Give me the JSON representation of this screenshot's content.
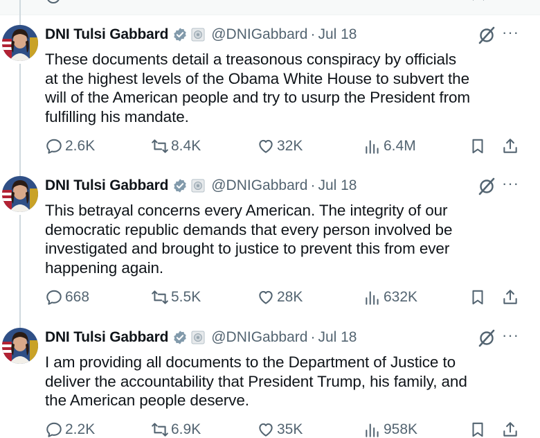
{
  "tweets": [
    {
      "author": "DNI Tulsi Gabbard",
      "handle": "@DNIGabbard",
      "date": "Jul 18",
      "text": "These documents detail a treasonous conspiracy by officials\nat the highest levels of the Obama White House to subvert the\nwill of the American people and try to usurp the President from\nfulfilling his mandate.",
      "replies": "2.6K",
      "reposts": "8.4K",
      "likes": "32K",
      "views": "6.4M"
    },
    {
      "author": "DNI Tulsi Gabbard",
      "handle": "@DNIGabbard",
      "date": "Jul 18",
      "text": "This betrayal concerns every American. The integrity of our\ndemocratic republic demands that every person involved be\ninvestigated and brought to justice to prevent this from ever\nhappening again.",
      "replies": "668",
      "reposts": "5.5K",
      "likes": "28K",
      "views": "632K"
    },
    {
      "author": "DNI Tulsi Gabbard",
      "handle": "@DNIGabbard",
      "date": "Jul 18",
      "text": "I am providing all documents to the Department of Justice to\ndeliver the accountability that President Trump, his family, and\nthe American people deserve.",
      "replies": "2.2K",
      "reposts": "6.9K",
      "likes": "35K",
      "views": "958K"
    }
  ],
  "ui": {
    "separator": "·",
    "more_label": "···"
  },
  "colors": {
    "text": "#0f1419",
    "secondary": "#536471",
    "verified_gray": "#829aab",
    "thread_line": "#cfd9de"
  },
  "icons": [
    "reply-icon",
    "retweet-icon",
    "like-icon",
    "views-icon",
    "bookmark-icon",
    "share-icon",
    "grok-icon",
    "verified-badge-icon",
    "affiliate-badge-icon"
  ]
}
